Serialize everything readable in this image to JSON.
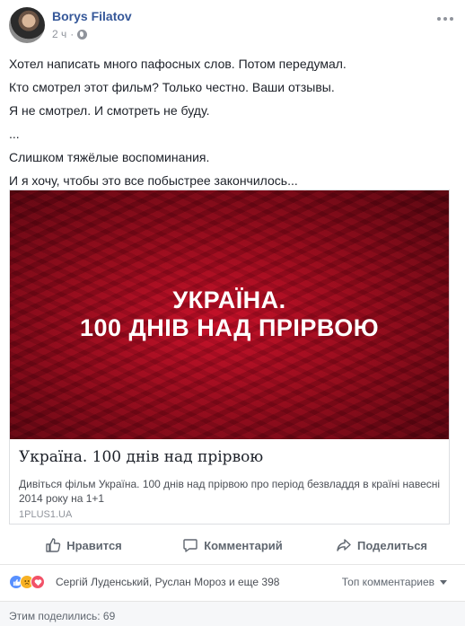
{
  "post": {
    "author": "Borys Filatov",
    "time": "2 ч",
    "dot": "·",
    "more_icon": "more-dots-icon",
    "privacy_icon": "globe-icon",
    "text_lines": [
      "Хотел написать много пафосных слов. Потом передумал.",
      "Кто смотрел этот фильм? Только честно. Ваши отзывы.",
      "Я не смотрел. И смотреть не буду.",
      "...",
      "Слишком тяжёлые воспоминания.",
      "И я хочу, чтобы это все побыстрее закончилось..."
    ]
  },
  "link_preview": {
    "image_title_line1": "УКРАЇНА.",
    "image_title_line2": "100 ДНІВ НАД ПРІРВОЮ",
    "title": "Україна. 100 днів над прірвою",
    "description": "Дивіться фільм Україна. 100 днів над прірвою про період безвладдя в країні навесні 2014 року на 1+1",
    "domain": "1PLUS1.UA",
    "image_colors": {
      "base": "#c8102e",
      "dark": "#5d0612"
    }
  },
  "actions": {
    "like": "Нравится",
    "comment": "Комментарий",
    "share": "Поделиться"
  },
  "reactions": {
    "names": "Сергій Луденський, Руслан Мороз и еще 398",
    "top_comments": "Топ комментариев",
    "icons": [
      "like-reaction-icon",
      "sad-reaction-icon",
      "love-reaction-icon"
    ],
    "colors": {
      "like": "#5890ff",
      "sad": "#f7b125",
      "love": "#f25268"
    }
  },
  "shares": {
    "label": "Этим поделились: 69"
  },
  "colors": {
    "author_link": "#365899",
    "secondary_text": "#90949c",
    "body_text": "#1d2129"
  }
}
